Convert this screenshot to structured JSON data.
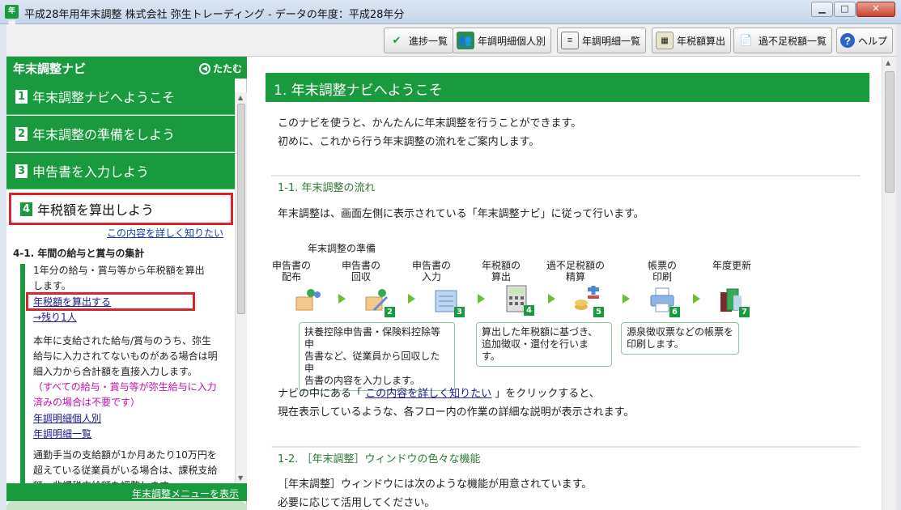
{
  "window": {
    "icon_text": "年調",
    "title": "平成28年用年末調整 株式会社 弥生トレーディング - データの年度：平成28年分",
    "min": "▁",
    "max": "□",
    "close": "✕"
  },
  "toolbar": {
    "progress": "進捗一覧",
    "detail_person": "年調明細個人別",
    "detail_list": "年調明細一覧",
    "tax_calc": "年税額算出",
    "shortfall": "過不足税額一覧",
    "help": "ヘルプ"
  },
  "nav": {
    "title": "年末調整ナビ",
    "fold": "たたむ",
    "steps": [
      {
        "num": "1",
        "label": "年末調整ナビへようこそ"
      },
      {
        "num": "2",
        "label": "年末調整の準備をしよう"
      },
      {
        "num": "3",
        "label": "申告書を入力しよう"
      },
      {
        "num": "4",
        "label": "年税額を算出しよう"
      }
    ],
    "more_link": "この内容を詳しく知りたい",
    "section_head": "4-1. 年間の給与と賞与の集計",
    "text1_l1": "1年分の給与・賞与等から年税額を算出",
    "text1_l2": "します。",
    "link_calc": "年税額を算出する",
    "link_remaining": "→残り1人",
    "text2_l1": "本年に支給された給与/賞与のうち、弥生",
    "text2_l2": "給与に入力されてないものがある場合は明",
    "text2_l3": "細入力から合計額を直接入力します。",
    "magenta_l1": "（すべての給与・賞与等が弥生給与に入力",
    "magenta_l2": "済みの場合は不要です）",
    "link_detail_person": "年調明細個人別",
    "link_detail_list": "年調明細一覧",
    "text3_l1": "通勤手当の支給額が1か月あたり10万円を",
    "text3_l2": "超えている従業員がいる場合は、課税支給",
    "text3_l3": "額・非課税支給額を調整します。",
    "bottom_link": "年末調整メニューを表示"
  },
  "main": {
    "title": "1. 年末調整ナビへようこそ",
    "intro_l1": "このナビを使うと、かんたんに年末調整を行うことができます。",
    "intro_l2": "初めに、これから行う年末調整の流れをご案内します。",
    "sec1_head": "1-1. 年末調整の流れ",
    "sec1_text": "年末調整は、画面左側に表示されている「年末調整ナビ」に従って行います。",
    "flow_group": "年末調整の準備",
    "flow": [
      {
        "l1": "申告書の",
        "l2": "配布",
        "num": ""
      },
      {
        "l1": "申告書の",
        "l2": "回収",
        "num": "2"
      },
      {
        "l1": "申告書の",
        "l2": "入力",
        "num": "3"
      },
      {
        "l1": "年税額の",
        "l2": "算出",
        "num": "4"
      },
      {
        "l1": "過不足税額の",
        "l2": "精算",
        "num": "5"
      },
      {
        "l1": "帳票の",
        "l2": "印刷",
        "num": "6"
      },
      {
        "l1": "年度更新",
        "l2": "",
        "num": "7"
      }
    ],
    "callout1_l1": "扶養控除申告書・保険料控除等申",
    "callout1_l2": "告書など、従業員から回収した申",
    "callout1_l3": "告書の内容を入力します。",
    "callout2_l1": "算出した年税額に基づき、",
    "callout2_l2": "追加徴収・還付を行います。",
    "callout3_l1": "源泉徴収票などの帳票を",
    "callout3_l2": "印刷します。",
    "navi_text_pre": "ナビの中にある「 ",
    "navi_text_link": "この内容を詳しく知りたい",
    "navi_text_post": " 」をクリックすると、",
    "navi_text_l2": "現在表示しているような、各フロー内の作業の詳細な説明が表示されます。",
    "sec2_head": "1-2. ［年末調整］ウィンドウの色々な機能",
    "sec2_l1": "［年末調整］ウィンドウには次のような機能が用意されています。",
    "sec2_l2": "必要に応じて活用してください。"
  },
  "colors": {
    "brand_green": "#1a9a3e",
    "highlight_red": "#d9232d",
    "link_blue": "#1a1a8a",
    "note_magenta": "#c010b0"
  }
}
